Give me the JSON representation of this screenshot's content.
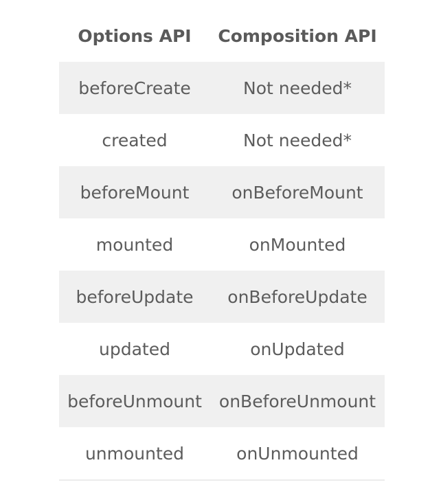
{
  "table": {
    "headers": [
      "Options API",
      "Composition API"
    ],
    "rows": [
      [
        "beforeCreate",
        "Not needed*"
      ],
      [
        "created",
        "Not needed*"
      ],
      [
        "beforeMount",
        "onBeforeMount"
      ],
      [
        "mounted",
        "onMounted"
      ],
      [
        "beforeUpdate",
        "onBeforeUpdate"
      ],
      [
        "updated",
        "onUpdated"
      ],
      [
        "beforeUnmount",
        "onBeforeUnmount"
      ],
      [
        "unmounted",
        "onUnmounted"
      ]
    ]
  },
  "colors": {
    "stripe": "#f0f0f0",
    "text": "#5c5c5c"
  }
}
